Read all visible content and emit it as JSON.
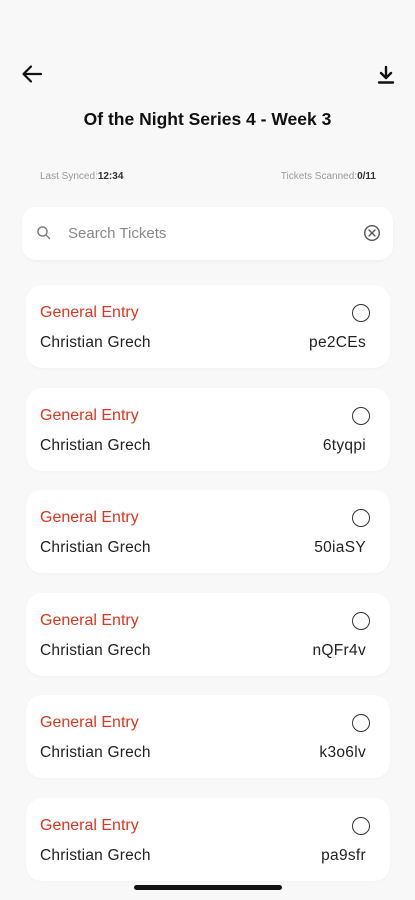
{
  "header": {
    "title": "Of the Night Series 4 - Week 3",
    "back_icon": "arrow-left",
    "download_icon": "download"
  },
  "sync": {
    "last_synced_label": "Last Synced:",
    "last_synced_value": "12:34",
    "tickets_scanned_label": "Tickets Scanned:",
    "tickets_scanned_value": "0/11"
  },
  "search": {
    "placeholder": "Search Tickets",
    "value": ""
  },
  "colors": {
    "accent": "#e0341f",
    "background": "#f8f8f8",
    "card": "#ffffff"
  },
  "tickets": [
    {
      "type": "General Entry",
      "holder": "Christian Grech",
      "code": "pe2CEs",
      "scanned": false
    },
    {
      "type": "General Entry",
      "holder": "Christian Grech",
      "code": "6tyqpi",
      "scanned": false
    },
    {
      "type": "General Entry",
      "holder": "Christian Grech",
      "code": "50iaSY",
      "scanned": false
    },
    {
      "type": "General Entry",
      "holder": "Christian Grech",
      "code": "nQFr4v",
      "scanned": false
    },
    {
      "type": "General Entry",
      "holder": "Christian Grech",
      "code": "k3o6lv",
      "scanned": false
    },
    {
      "type": "General Entry",
      "holder": "Christian Grech",
      "code": "pa9sfr",
      "scanned": false
    }
  ]
}
